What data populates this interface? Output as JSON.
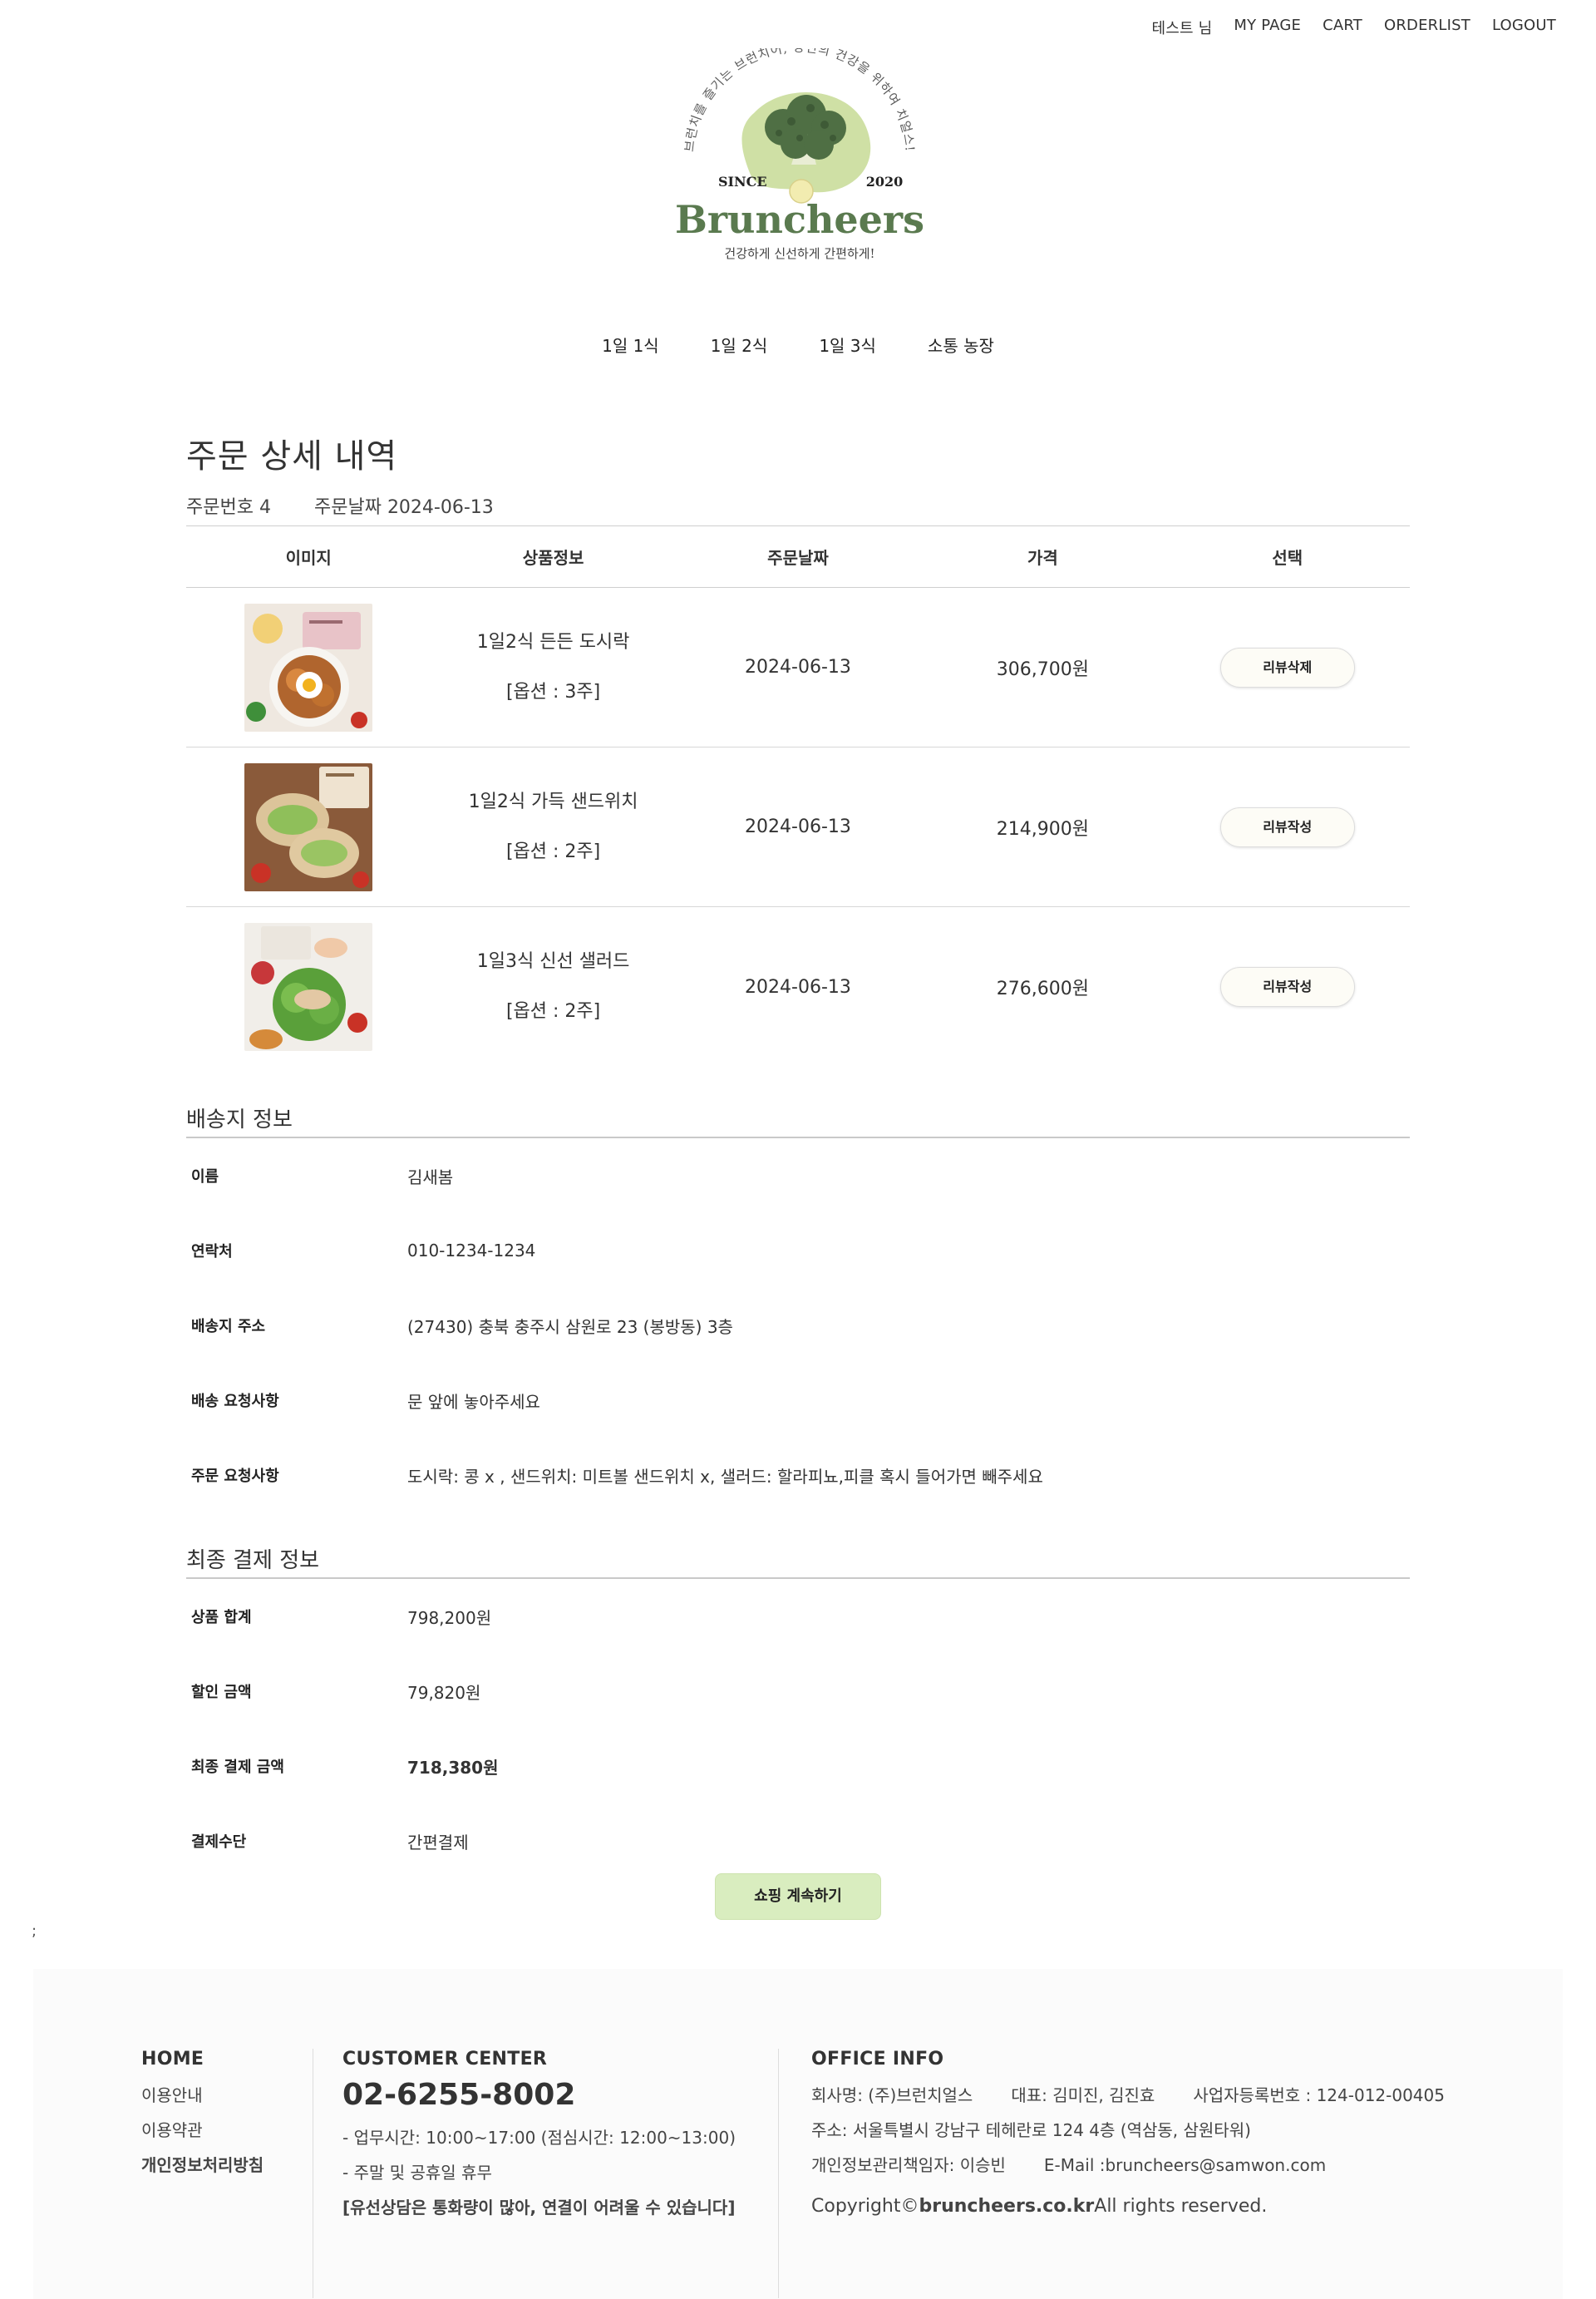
{
  "top_nav": {
    "user": "테스트 님",
    "mypage": "MY PAGE",
    "cart": "CART",
    "orderlist": "ORDERLIST",
    "logout": "LOGOUT"
  },
  "logo": {
    "arc_text": "브런치를 즐기는 브런치어, 당신의 건강을 위하여 치얼스!",
    "since": "SINCE",
    "year": "2020",
    "brand": "Bruncheers",
    "tagline": "건강하게 신선하게 간편하게!",
    "brand_color": "#5a7a4f",
    "blob_color": "#cfe0a5"
  },
  "cat_nav": [
    "1일 1식",
    "1일 2식",
    "1일 3식",
    "소통 농장"
  ],
  "order": {
    "title": "주문 상세 내역",
    "number_label": "주문번호",
    "number": "4",
    "date_label": "주문날짜",
    "date": "2024-06-13"
  },
  "product_table": {
    "headers": [
      "이미지",
      "상품정보",
      "주문날짜",
      "가격",
      "선택"
    ],
    "rows": [
      {
        "image": "dosirak-photo",
        "name": "1일2식 든든 도시락",
        "option": "[옵션 : 3주]",
        "date": "2024-06-13",
        "price": "306,700원",
        "action": "리뷰삭제"
      },
      {
        "image": "sandwich-photo",
        "name": "1일2식 가득 샌드위치",
        "option": "[옵션 : 2주]",
        "date": "2024-06-13",
        "price": "214,900원",
        "action": "리뷰작성"
      },
      {
        "image": "salad-photo",
        "name": "1일3식 신선 샐러드",
        "option": "[옵션 : 2주]",
        "date": "2024-06-13",
        "price": "276,600원",
        "action": "리뷰작성"
      }
    ]
  },
  "shipping": {
    "title": "배송지 정보",
    "rows": [
      {
        "label": "이름",
        "value": "김새봄"
      },
      {
        "label": "연락처",
        "value": "010-1234-1234"
      },
      {
        "label": "배송지 주소",
        "value": "(27430)   충북 충주시 삼원로 23 (봉방동) 3층"
      },
      {
        "label": "배송 요청사항",
        "value": "문 앞에 놓아주세요"
      },
      {
        "label": "주문 요청사항",
        "value": "도시락: 콩 x , 샌드위치: 미트볼 샌드위치 x, 샐러드: 할라피뇨,피클 혹시 들어가면 빼주세요"
      }
    ]
  },
  "payment": {
    "title": "최종 결제 정보",
    "rows": [
      {
        "label": "상품 합계",
        "value": "798,200원"
      },
      {
        "label": "할인 금액",
        "value": "79,820원"
      },
      {
        "label": "최종 결제 금액",
        "value": "718,380원"
      },
      {
        "label": "결제수단",
        "value": "간편결제"
      }
    ]
  },
  "continue_button": "쇼핑 계속하기",
  "stray_mark": ";",
  "footer": {
    "col1": {
      "home": "HOME",
      "guide": "이용안내",
      "terms": "이용약관",
      "privacy": "개인정보처리방침"
    },
    "col2": {
      "title": "CUSTOMER CENTER",
      "phone": "02-6255-8002",
      "hours": "- 업무시간: 10:00~17:00 (점심시간: 12:00~13:00)",
      "holiday": "- 주말 및 공휴일 휴무",
      "notice": "[유선상담은 통화량이 많아, 연결이 어려울 수 있습니다]"
    },
    "col3": {
      "title": "OFFICE INFO",
      "company": "회사명: (주)브런치얼스",
      "ceo": "대표: 김미진, 김진효",
      "bizno": "사업자등록번호 : 124-012-00405",
      "address": "주소: 서울특별시 강남구 테헤란로 124 4층 (역삼동, 삼원타워)",
      "officer": "개인정보관리책임자: 이승빈",
      "email": "E-Mail :bruncheers@samwon.com",
      "copy_prefix": "Copyright©",
      "copy_domain": "bruncheers.co.kr",
      "copy_suffix": "All rights reserved."
    }
  }
}
